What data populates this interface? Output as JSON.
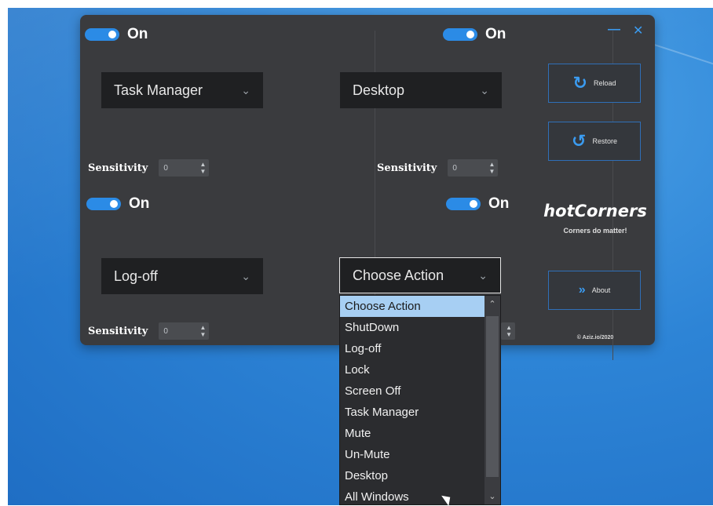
{
  "corners": {
    "top_left": {
      "toggle": "On",
      "action": "Task Manager",
      "sensitivity_label": "Sensitivity",
      "sensitivity_value": "0"
    },
    "top_right": {
      "toggle": "On",
      "action": "Desktop",
      "sensitivity_label": "Sensitivity",
      "sensitivity_value": "0"
    },
    "bottom_left": {
      "toggle": "On",
      "action": "Log-off",
      "sensitivity_label": "Sensitivity",
      "sensitivity_value": "0"
    },
    "bottom_right": {
      "toggle": "On",
      "action": "Choose Action"
    }
  },
  "side": {
    "reload_label": "Reload",
    "restore_label": "Restore",
    "brand": "hotCorners",
    "tagline": "Corners do matter!",
    "about_label": "About",
    "copyright": "© Aziz.io/2020"
  },
  "window": {
    "minimize": "—",
    "close": "✕"
  },
  "dropdown_options": [
    "Choose Action",
    "ShutDown",
    "Log-off",
    "Lock",
    "Screen Off",
    "Task Manager",
    "Mute",
    "Un-Mute",
    "Desktop",
    "All Windows"
  ],
  "colors": {
    "accent": "#2b8be6",
    "panel": "#3a3b3e",
    "selection": "#a7cff3"
  }
}
